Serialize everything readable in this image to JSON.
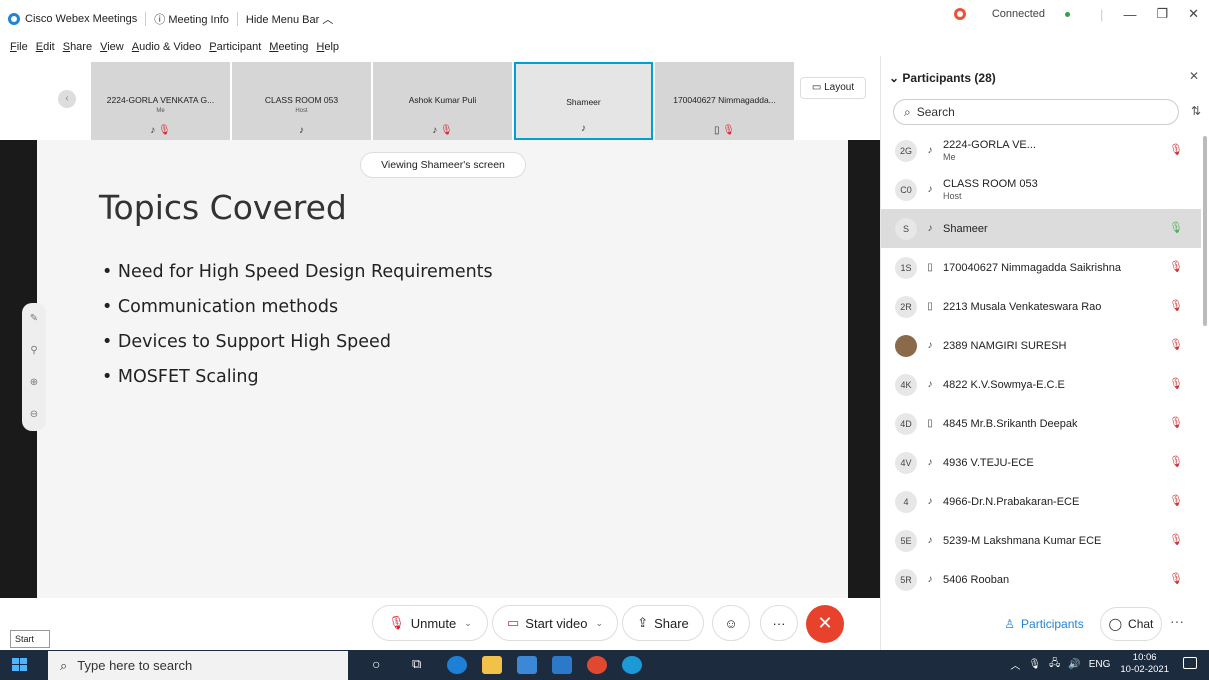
{
  "titlebar": {
    "app_name": "Cisco Webex Meetings",
    "meeting_info": "ⓘ Meeting Info",
    "hide_menu": "Hide Menu Bar ︿",
    "connected": "Connected"
  },
  "menu": [
    "File",
    "Edit",
    "Share",
    "View",
    "Audio & Video",
    "Participant",
    "Meeting",
    "Help"
  ],
  "strip": {
    "tiles": [
      {
        "name": "2224-GORLA VENKATA G...",
        "role": "Me",
        "icons": "♪ 🎙"
      },
      {
        "name": "CLASS ROOM 053",
        "role": "Host",
        "icons": "♪"
      },
      {
        "name": "Ashok Kumar Puli",
        "role": "",
        "icons": "♪ 🎙"
      },
      {
        "name": "Shameer",
        "role": "",
        "icons": "♪"
      },
      {
        "name": "170040627 Nimmagadda...",
        "role": "",
        "icons": "▯ 🎙"
      }
    ],
    "layout_label": "Layout"
  },
  "share": {
    "viewing": "Viewing Shameer's screen",
    "slide_title": "Topics Covered",
    "bullets": [
      "Need for High Speed Design Requirements",
      "Communication methods",
      "Devices to Support High Speed",
      "MOSFET Scaling"
    ]
  },
  "toolbar": {
    "unmute": "Unmute",
    "start_video": "Start video",
    "share": "Share",
    "more": "···",
    "start_tip": "Start"
  },
  "panel": {
    "title": "Participants (28)",
    "search_placeholder": "Search",
    "participants": [
      {
        "initials": "2G",
        "device": "♪",
        "name": "2224-GORLA VE...",
        "role": "Me",
        "muted": true
      },
      {
        "initials": "C0",
        "device": "♪",
        "name": "CLASS ROOM 053",
        "role": "Host",
        "muted": false
      },
      {
        "initials": "S",
        "device": "♪",
        "name": "Shameer",
        "role": "",
        "muted": false,
        "speaking": true
      },
      {
        "initials": "1S",
        "device": "▯",
        "name": "170040627 Nimmagadda Saikrishna",
        "role": "",
        "muted": true
      },
      {
        "initials": "2R",
        "device": "▯",
        "name": "2213 Musala Venkateswara Rao",
        "role": "",
        "muted": true
      },
      {
        "initials": "",
        "device": "♪",
        "name": "2389 NAMGIRI SURESH",
        "role": "",
        "muted": true,
        "photo": true
      },
      {
        "initials": "4K",
        "device": "♪",
        "name": "4822 K.V.Sowmya-E.C.E",
        "role": "",
        "muted": true
      },
      {
        "initials": "4D",
        "device": "▯",
        "name": "4845 Mr.B.Srikanth Deepak",
        "role": "",
        "muted": true
      },
      {
        "initials": "4V",
        "device": "♪",
        "name": "4936 V.TEJU-ECE",
        "role": "",
        "muted": true
      },
      {
        "initials": "4",
        "device": "♪",
        "name": "4966-Dr.N.Prabakaran-ECE",
        "role": "",
        "muted": true
      },
      {
        "initials": "5E",
        "device": "♪",
        "name": "5239-M Lakshmana Kumar ECE",
        "role": "",
        "muted": true
      },
      {
        "initials": "5R",
        "device": "♪",
        "name": "5406 Rooban",
        "role": "",
        "muted": true
      }
    ],
    "participants_btn": "Participants",
    "chat_btn": "Chat"
  },
  "taskbar": {
    "search": "Type here to search",
    "lang": "ENG",
    "time": "10:06",
    "date": "10-02-2021"
  }
}
